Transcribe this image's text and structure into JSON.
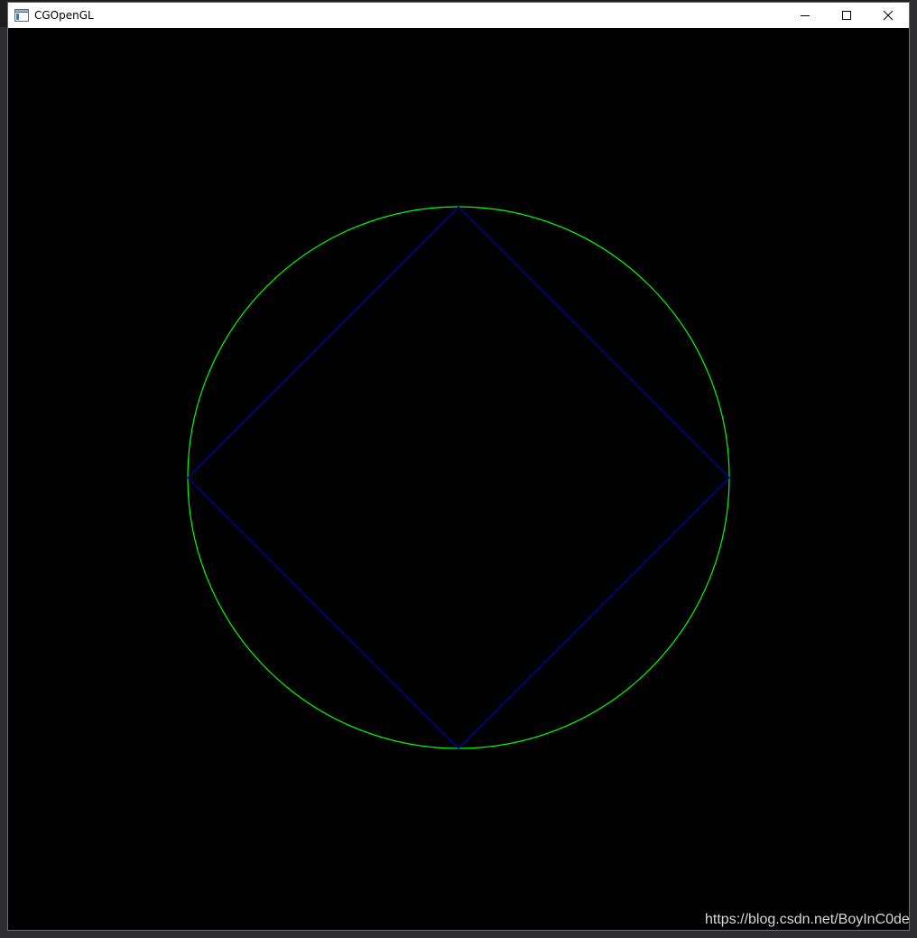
{
  "window": {
    "title": "CGOpenGL",
    "controls": {
      "minimize": "minimize-icon",
      "maximize": "maximize-icon",
      "close": "close-icon"
    }
  },
  "scene": {
    "background": "#000000",
    "circle_color": "#00ff00",
    "diamond_color": "#0000a8"
  },
  "watermark": "https://blog.csdn.net/BoyInC0de"
}
